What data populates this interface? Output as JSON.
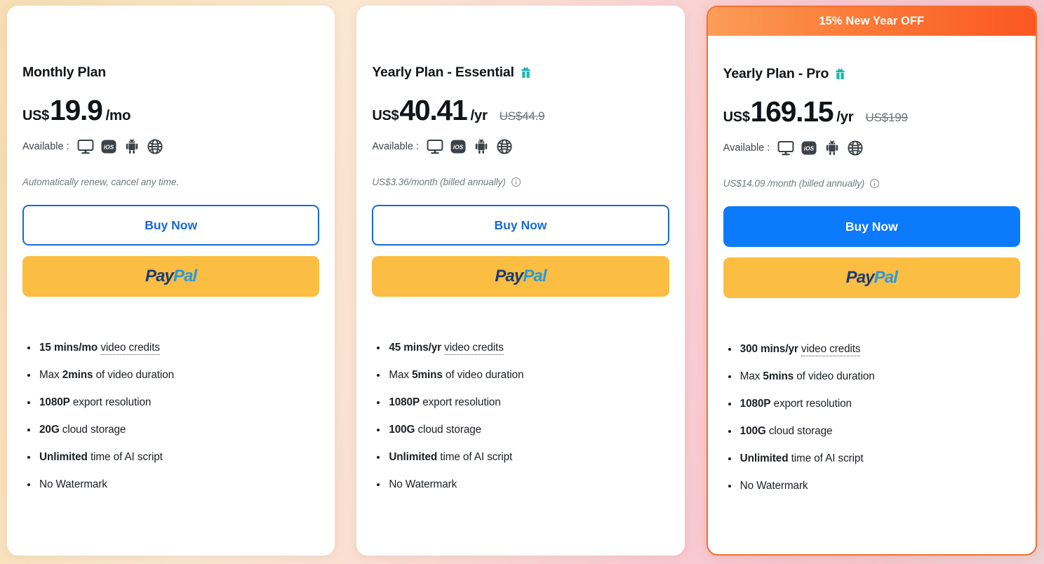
{
  "background": {
    "gradient_from": "#f6dfb4",
    "gradient_to": "#efd3d6"
  },
  "colors": {
    "accent_blue": "#0b7afb",
    "outline_blue": "#1769d6",
    "paypal_yellow": "#fbbd42",
    "promo_orange_from": "#fb9d58",
    "promo_orange_to": "#fb5722",
    "highlight_border": "#f1702f",
    "gift_teal": "#19b6ae"
  },
  "available_label": "Available :",
  "platform_icons": [
    "desktop-icon",
    "ios-icon",
    "android-icon",
    "web-globe-icon"
  ],
  "plans": [
    {
      "id": "monthly",
      "promo": null,
      "title": "Monthly Plan",
      "has_gift": false,
      "currency": "US$",
      "amount": "19.9",
      "period": "/mo",
      "old_price": "",
      "note": "Automatically renew, cancel any time.",
      "has_info_icon": false,
      "buy_label": "Buy Now",
      "buy_style": "outline",
      "paypal_pay": "Pay",
      "paypal_pal": "Pal",
      "features": [
        {
          "strong": "15 mins/mo",
          "text": " ",
          "dotted": "video credits",
          "tail": ""
        },
        {
          "pre": "Max ",
          "strong": "2mins",
          "tail": " of video duration"
        },
        {
          "strong": "1080P",
          "tail": " export resolution"
        },
        {
          "strong": "20G",
          "tail": " cloud storage"
        },
        {
          "strong": "Unlimited",
          "tail": " time of AI script"
        },
        {
          "pre": "No Watermark"
        }
      ]
    },
    {
      "id": "yearly-essential",
      "promo": null,
      "title": "Yearly Plan - Essential",
      "has_gift": true,
      "currency": "US$",
      "amount": "40.41",
      "period": "/yr",
      "old_price": "US$44.9",
      "note": "US$3.36/month (billed annually)",
      "has_info_icon": true,
      "buy_label": "Buy Now",
      "buy_style": "outline",
      "paypal_pay": "Pay",
      "paypal_pal": "Pal",
      "features": [
        {
          "strong": "45 mins/yr",
          "text": " ",
          "dotted": "video credits",
          "tail": ""
        },
        {
          "pre": "Max ",
          "strong": "5mins",
          "tail": " of video duration"
        },
        {
          "strong": "1080P",
          "tail": " export resolution"
        },
        {
          "strong": "100G",
          "tail": " cloud storage"
        },
        {
          "strong": "Unlimited",
          "tail": " time of AI script"
        },
        {
          "pre": "No Watermark"
        }
      ]
    },
    {
      "id": "yearly-pro",
      "promo": "15% New Year OFF",
      "title": "Yearly Plan - Pro",
      "has_gift": true,
      "currency": "US$",
      "amount": "169.15",
      "period": "/yr",
      "old_price": "US$199",
      "note": "US$14.09 /month (billed annually)",
      "has_info_icon": true,
      "buy_label": "Buy Now",
      "buy_style": "filled",
      "paypal_pay": "Pay",
      "paypal_pal": "Pal",
      "features": [
        {
          "strong": "300 mins/yr",
          "text": " ",
          "dotted": "video credits",
          "tail": ""
        },
        {
          "pre": "Max ",
          "strong": "5mins",
          "tail": " of video duration"
        },
        {
          "strong": "1080P",
          "tail": " export resolution"
        },
        {
          "strong": "100G",
          "tail": " cloud storage"
        },
        {
          "strong": "Unlimited",
          "tail": " time of AI script"
        },
        {
          "pre": "No Watermark"
        }
      ]
    }
  ]
}
